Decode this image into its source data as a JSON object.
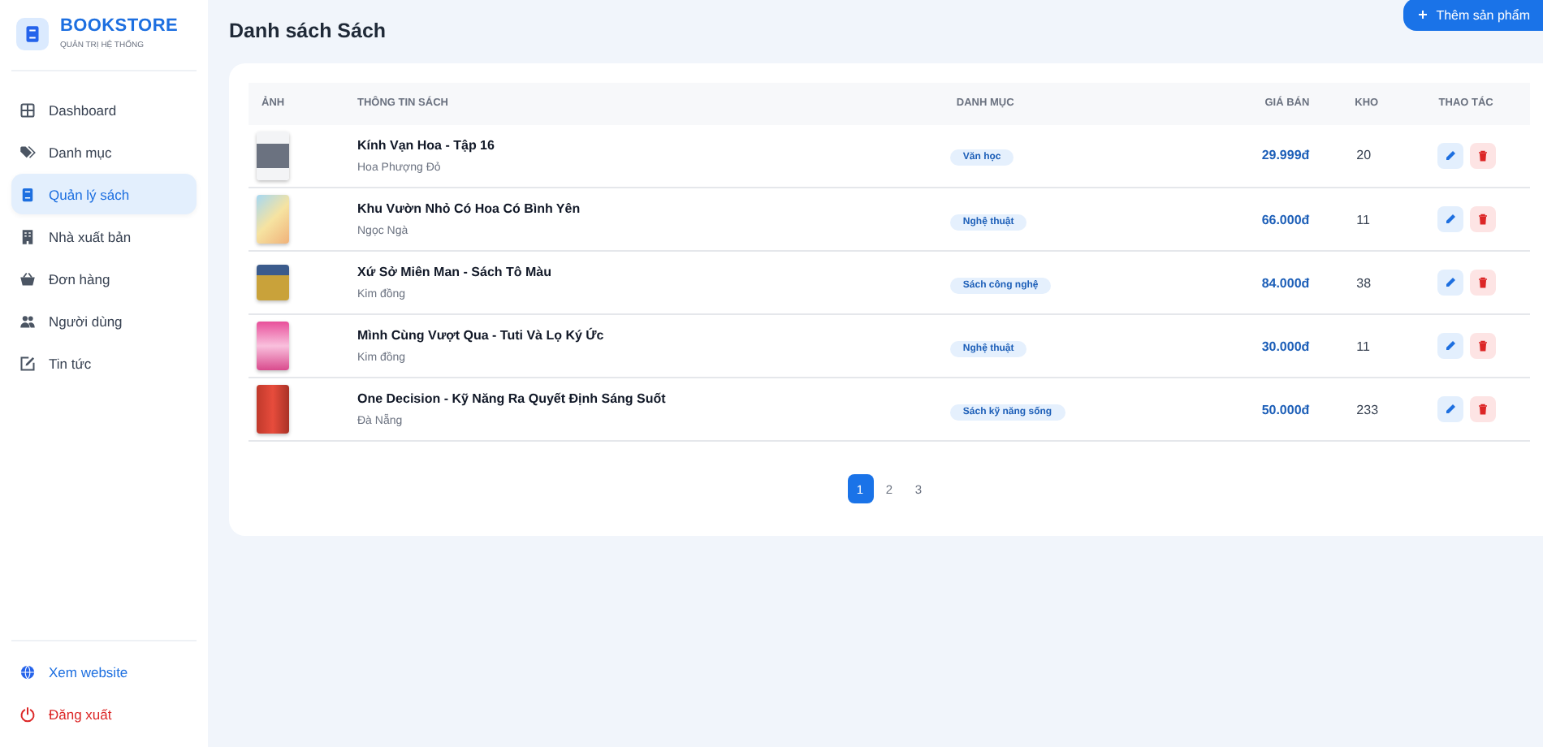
{
  "brand": {
    "name": "BOOKSTORE",
    "subtitle": "QUẢN TRỊ HỆ THỐNG"
  },
  "sidebar": {
    "items": [
      {
        "label": "Dashboard",
        "selected": false
      },
      {
        "label": "Danh mục",
        "selected": false
      },
      {
        "label": "Quản lý sách",
        "selected": true
      },
      {
        "label": "Nhà xuất bản",
        "selected": false
      },
      {
        "label": "Đơn hàng",
        "selected": false
      },
      {
        "label": "Người dùng",
        "selected": false
      },
      {
        "label": "Tin tức",
        "selected": false
      }
    ],
    "footer": [
      {
        "label": "Xem website",
        "kind": "link"
      },
      {
        "label": "Đăng xuất",
        "kind": "danger"
      }
    ]
  },
  "page_title": "Danh sách Sách",
  "add_button": "Thêm sản phẩm",
  "table": {
    "columns": [
      "ẢNH",
      "THÔNG TIN SÁCH",
      "DANH MỤC",
      "GIÁ BÁN",
      "KHO",
      "THAO TÁC"
    ],
    "rows": [
      {
        "title": "Kính Vạn Hoa - Tập 16",
        "publisher": "Hoa Phượng Đỏ",
        "category": "Văn học",
        "price": "29.999đ",
        "stock": "20"
      },
      {
        "title": "Khu Vườn Nhỏ Có Hoa Có Bình Yên",
        "publisher": "Ngọc Ngà",
        "category": "Nghệ thuật",
        "price": "66.000đ",
        "stock": "11"
      },
      {
        "title": "Xứ Sở Miên Man - Sách Tô Màu",
        "publisher": "Kim đồng",
        "category": "Sách công nghệ",
        "price": "84.000đ",
        "stock": "38"
      },
      {
        "title": "Mình Cùng Vượt Qua - Tuti Và Lọ Ký Ức",
        "publisher": "Kim đồng",
        "category": "Nghệ thuật",
        "price": "30.000đ",
        "stock": "11"
      },
      {
        "title": "One Decision - Kỹ Năng Ra Quyết Định Sáng Suốt",
        "publisher": "Đà Nẵng",
        "category": "Sách kỹ năng sống",
        "price": "50.000đ",
        "stock": "233"
      }
    ]
  },
  "pagination": [
    {
      "label": "1",
      "selected": true
    },
    {
      "label": "2",
      "selected": false
    },
    {
      "label": "3",
      "selected": false
    }
  ]
}
